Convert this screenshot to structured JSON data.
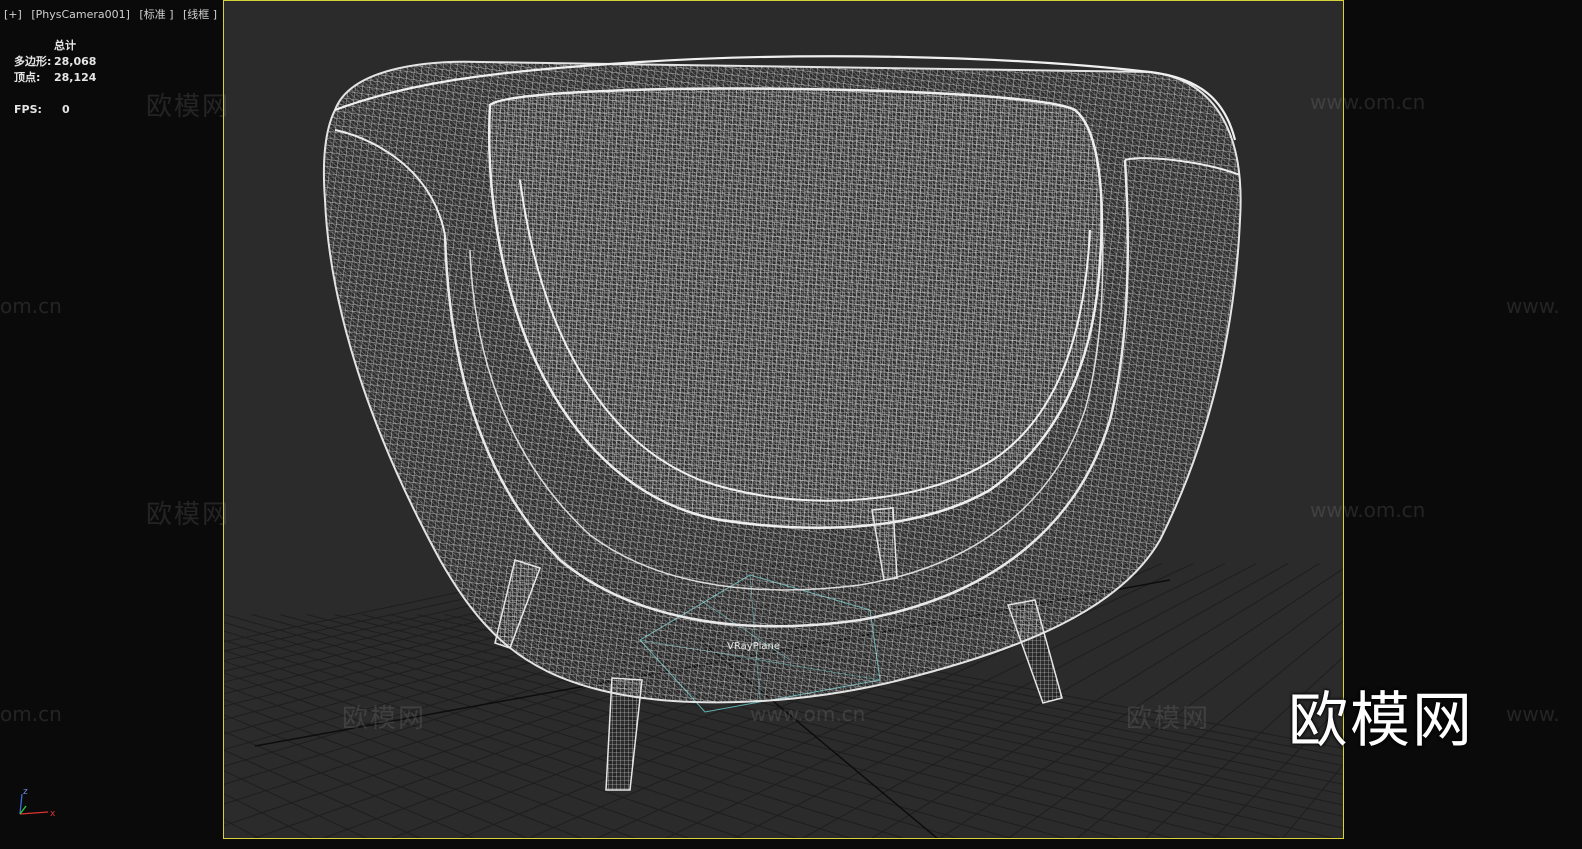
{
  "viewport_label": {
    "plus": "[+]",
    "camera": "[PhysCamera001]",
    "shading": "[标准 ]",
    "mode": "[线框 ]"
  },
  "stats": {
    "header": "总计",
    "polygons_label": "多边形:",
    "polygons_value": "28,068",
    "vertices_label": "顶点:",
    "vertices_value": "28,124",
    "fps_label": "FPS:",
    "fps_value": "0"
  },
  "scene_object_label": "VRayPlane",
  "watermarks": {
    "cn": "欧模网",
    "url": "www.om.cn",
    "url_partial_left": "om.cn",
    "url_partial_right": "www."
  },
  "brand_logo": "欧模网",
  "gizmo": {
    "x": "x",
    "z": "z"
  },
  "colors": {
    "viewport_bg": "#2b2b2b",
    "outside_bg": "#0a0a0a",
    "safe_frame": "#d8d23a",
    "wireframe": "#d9d9d9",
    "grid": "#1e1e1e",
    "vray_plane": "#6fd3d3"
  }
}
